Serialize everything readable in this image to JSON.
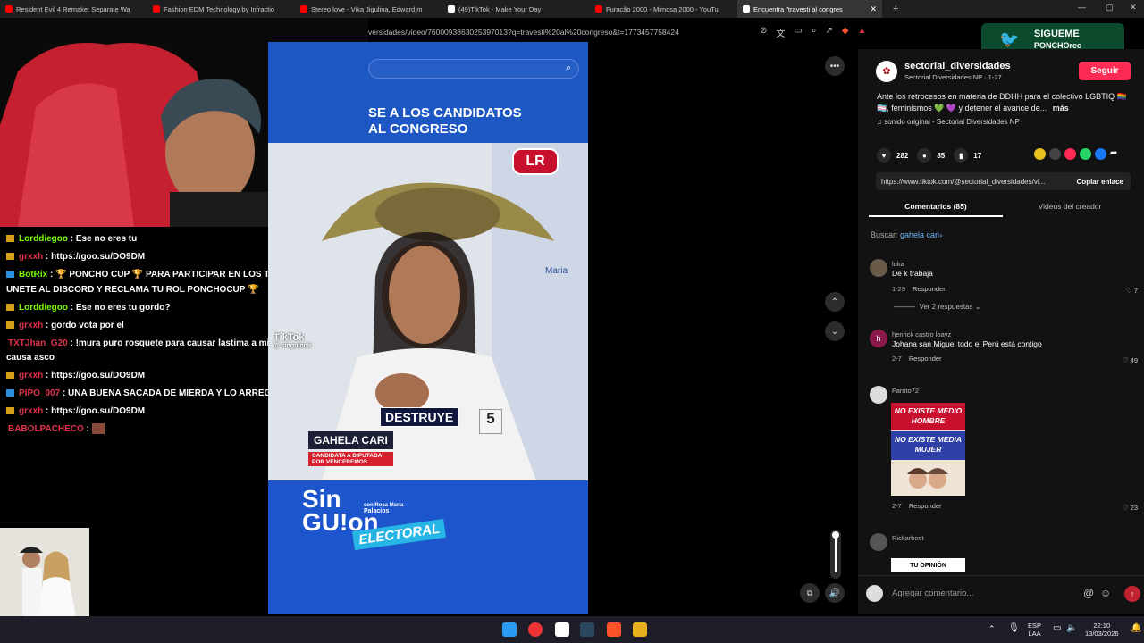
{
  "tabs": [
    {
      "label": "Resident Evil 4 Remake: Separate Wa",
      "color": "#ff0000",
      "active": false
    },
    {
      "label": "Fashion EDM Technology by Infractio",
      "color": "#ff0000",
      "active": false
    },
    {
      "label": "Stereo love - Vika Jigulina, Edward m",
      "color": "#ff0000",
      "active": false
    },
    {
      "label": "(49)TikTok - Make Your Day",
      "color": "#ffffff",
      "active": false
    },
    {
      "label": "Furacão 2000 - Mimosa 2000 - YouTu",
      "color": "#ff0000",
      "active": false
    },
    {
      "label": "Encuentra \"travesti al congres",
      "color": "#ffffff",
      "active": true
    }
  ],
  "address": {
    "url": "versidades/video/7600093863025397013?q=travesti%20al%20congreso&t=1773457758424"
  },
  "overlay": {
    "line1": "SIGUEME",
    "line2": "PONCHOrec"
  },
  "chat": [
    {
      "user": "Lorddiegoo",
      "user_color": "#7cfc00",
      "text": ": Ese no eres tu",
      "badge": "gold"
    },
    {
      "user": "grxxh",
      "user_color": "#e0314b",
      "text": ": https://goo.su/DO9DM",
      "badge": "gold"
    },
    {
      "user": "BotRix",
      "user_color": "#7cfc00",
      "text": ": 🏆 PONCHO CUP 🏆 PARA PARTICIPAR EN LOS TORNEOS UNETE AL DISCORD Y RECLAMA TU ROL PONCHOCUP 🏆",
      "badge": "blue"
    },
    {
      "user": "Lorddiegoo",
      "user_color": "#7cfc00",
      "text": ": Ese no eres tu gordo?",
      "badge": "gold"
    },
    {
      "user": "grxxh",
      "user_color": "#e0314b",
      "text": ": gordo vota por el",
      "badge": "gold"
    },
    {
      "user": "TXTJhan_G20",
      "user_color": "#e0314b",
      "text": ": !mura puro rosquete para causar lastima a mi me causa asco",
      "badge": "none"
    },
    {
      "user": "grxxh",
      "user_color": "#e0314b",
      "text": ": https://goo.su/DO9DM",
      "badge": "gold"
    },
    {
      "user": "PIPO_007",
      "user_color": "#e0314b",
      "text": ": UNA BUENA SACADA DE MIERDA Y LO ARREGLO",
      "badge": "blue"
    },
    {
      "user": "grxxh",
      "user_color": "#e0314b",
      "text": ": https://goo.su/DO9DM",
      "badge": "gold"
    },
    {
      "user": "BABOLPACHECO",
      "user_color": "#e0314b",
      "text": ":",
      "badge": "none"
    }
  ],
  "video": {
    "headline1": "SE A LOS CANDIDATOS",
    "headline2": "AL CONGRESO",
    "lr_logo": "LR",
    "tiktok_logo": "TikTok",
    "tiktok_handle": "@ singuionlr",
    "maria_text": "Maria",
    "destruye": "DESTRUYE",
    "badge_number": "5",
    "candidate_name": "GAHELA CARI",
    "candidate_sub": "CANDIDATA A DIPUTADA POR VENCEREMOS",
    "logo_line1": "Sin",
    "logo_line2": "GU!on",
    "logo_sub1": "con Rosa María",
    "logo_sub2": "Palacios",
    "logo_electoral": "ELECTORAL"
  },
  "creator": {
    "avatar": "✿",
    "name": "sectorial_diversidades",
    "subtitle": "Sectorial Diversidades NP · 1-27",
    "follow_label": "Seguir",
    "description": "Ante los retrocesos en materia de DDHH para el colectivo LGBTIQ 🏳️‍🌈🏳️‍⚧️, feminismos 💚 💜 y detener el avance de...",
    "more_label": "más",
    "sound": "sonido original - Sectorial Diversidades NP"
  },
  "stats": {
    "likes": "282",
    "comments": "85",
    "saves": "17"
  },
  "link": {
    "url": "https://www.tiktok.com/@sectorial_diversidades/vi...",
    "copy_label": "Copiar enlace"
  },
  "comment_tabs": {
    "comments": "Comentarios (85)",
    "creator_videos": "Videos del creador"
  },
  "search_label": "Buscar:",
  "search_term": "gahela cari",
  "comments": [
    {
      "user": "luka",
      "text": "De k trabaja",
      "date": "1-29",
      "reply": "Responder",
      "likes": "7"
    },
    {
      "user": "henrick castro loayz",
      "text": "Johana san Miguel todo el Perú está contigo",
      "date": "2-7",
      "reply": "Responder",
      "likes": "49"
    },
    {
      "user": "Farrito72",
      "text": "",
      "date": "2-7",
      "reply": "Responder",
      "likes": "23"
    },
    {
      "user": "Rickarbost",
      "text": "",
      "date": "",
      "reply": "",
      "likes": ""
    }
  ],
  "view_replies": "Ver 2 respuestas",
  "comment_image": {
    "line1": "NO EXISTE MEDIO HOMBRE",
    "line2": "NO EXISTE MEDIA MUJER"
  },
  "comment_image2": "TU OPINIÓN",
  "add_comment_placeholder": "Agregar comentario...",
  "tray": {
    "lang1": "ESP",
    "lang2": "LAA",
    "time": "22:10",
    "date": "13/03/2026"
  }
}
